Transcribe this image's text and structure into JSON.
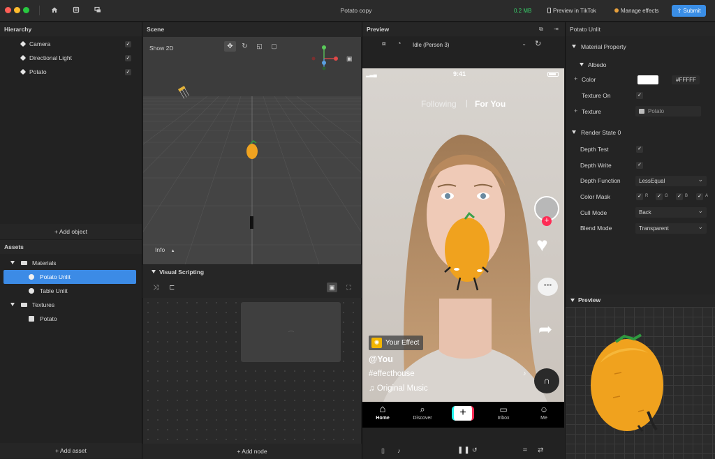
{
  "titlebar": {
    "title": "Potato copy",
    "size": "0.2 MB",
    "preview_tiktok": "Preview in TikTok",
    "manage_effects": "Manage effects",
    "submit": "Submit",
    "colors": {
      "close": "#ff5f57",
      "minimize": "#febc2e",
      "maximize": "#28c840",
      "accent": "#3a8ee6",
      "size": "#39d36c"
    }
  },
  "hierarchy": {
    "title": "Hierarchy",
    "items": [
      {
        "label": "Camera"
      },
      {
        "label": "Directional Light"
      },
      {
        "label": "Potato"
      }
    ],
    "add_button": "+ Add object"
  },
  "assets": {
    "title": "Assets",
    "materials_folder": "Materials",
    "materials": [
      "Potato Unlit",
      "Table Unlit"
    ],
    "textures_folder": "Textures",
    "textures": [
      "Potato"
    ],
    "add_button": "+ Add asset"
  },
  "scene": {
    "title": "Scene",
    "show2d": "Show 2D",
    "info": "Info",
    "visual_scripting": "Visual Scripting",
    "add_node": "+ Add node"
  },
  "preview": {
    "title": "Preview",
    "select_value": "Idle (Person 3)",
    "status_time": "9:41",
    "feed_following": "Following",
    "feed_for_you": "For You",
    "effect_badge": "Your Effect",
    "username": "@You",
    "hashtag": "#effecthouse",
    "music": "Original Music",
    "nav": [
      "Home",
      "Discover",
      "",
      "Inbox",
      "Me"
    ]
  },
  "properties": {
    "title": "Potato Unlit",
    "material_property": "Material Property",
    "albedo": "Albedo",
    "color_label": "Color",
    "color_hex": "#FFFFF",
    "texture_on": "Texture On",
    "texture_label": "Texture",
    "texture_value": "Potato",
    "render_state": "Render State 0",
    "depth_test": "Depth Test",
    "depth_write": "Depth Write",
    "depth_function": "Depth Function",
    "depth_function_value": "LessEqual",
    "color_mask": "Color Mask",
    "mask_channels": [
      "R",
      "G",
      "B",
      "A"
    ],
    "cull_mode": "Cull Mode",
    "cull_mode_value": "Back",
    "blend_mode": "Blend Mode",
    "blend_mode_value": "Transparent",
    "preview_title": "Preview"
  }
}
